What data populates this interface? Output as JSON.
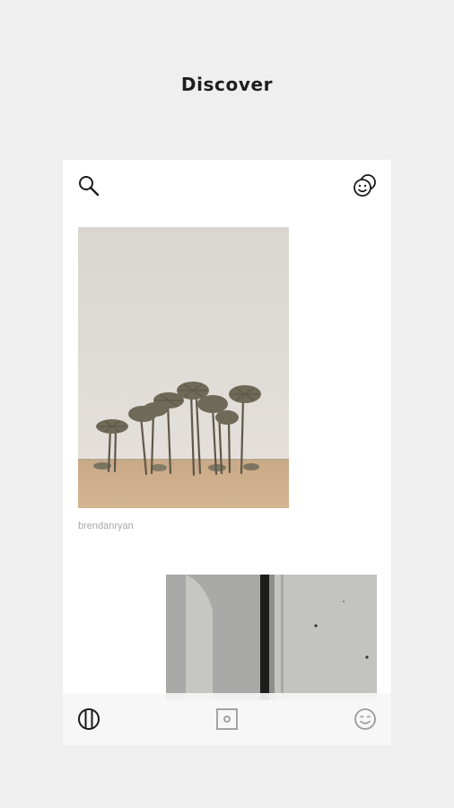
{
  "header": {
    "title": "Discover"
  },
  "toolbar": {
    "search_icon": "search-icon",
    "profile_icon": "face-bubble-icon"
  },
  "feed": {
    "items": [
      {
        "credit": "brendanryan",
        "subject": "palm trees in desert"
      },
      {
        "credit": "",
        "subject": "concrete wall"
      }
    ]
  },
  "tabbar": {
    "tabs": [
      {
        "icon": "columns-circle-icon",
        "active": true
      },
      {
        "icon": "square-dot-icon",
        "active": false
      },
      {
        "icon": "smile-face-icon",
        "active": false
      }
    ]
  },
  "colors": {
    "background": "#efefef",
    "card": "#ffffff",
    "icon_active": "#1a1a1a",
    "icon_inactive": "#9a9a9a"
  }
}
